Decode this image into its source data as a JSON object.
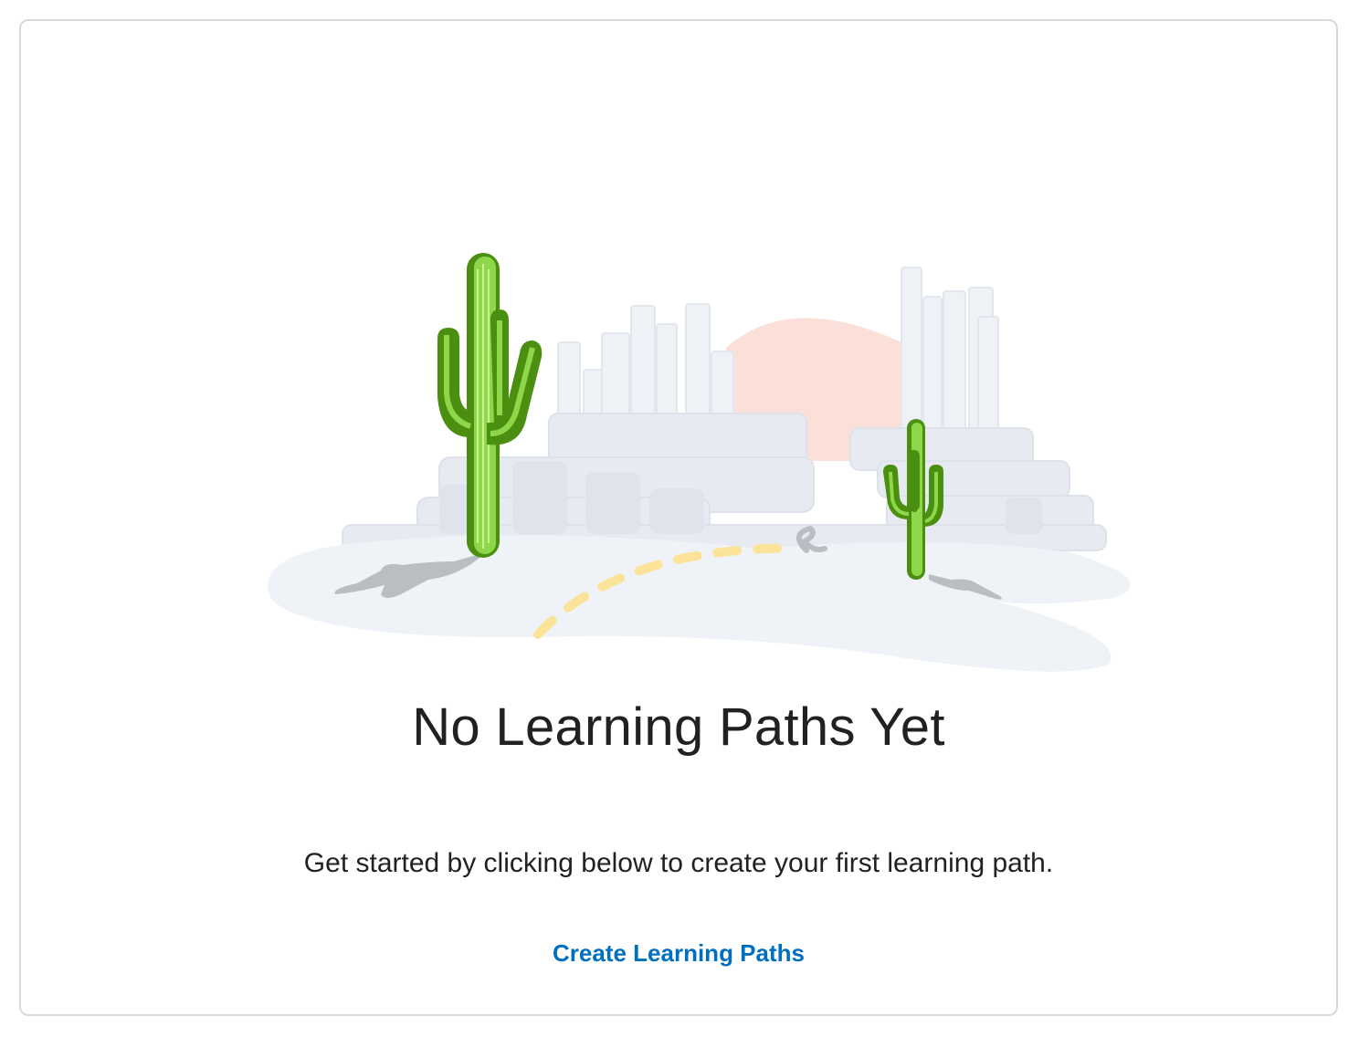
{
  "empty_state": {
    "title": "No Learning Paths Yet",
    "description": "Get started by clicking below to create your first learning path.",
    "action_label": "Create Learning Paths",
    "illustration": "desert-cactus-illustration"
  },
  "colors": {
    "title_text": "#202122",
    "link": "#006fbf",
    "border": "#d6dadf",
    "cactus_dark": "#4a8f0f",
    "cactus_light": "#8fd74a",
    "sun": "#fbe0da",
    "ground": "#eef2f6",
    "city": "#e6ebf1",
    "road_dash": "#fbe49a",
    "shadow": "#b9bec3"
  }
}
